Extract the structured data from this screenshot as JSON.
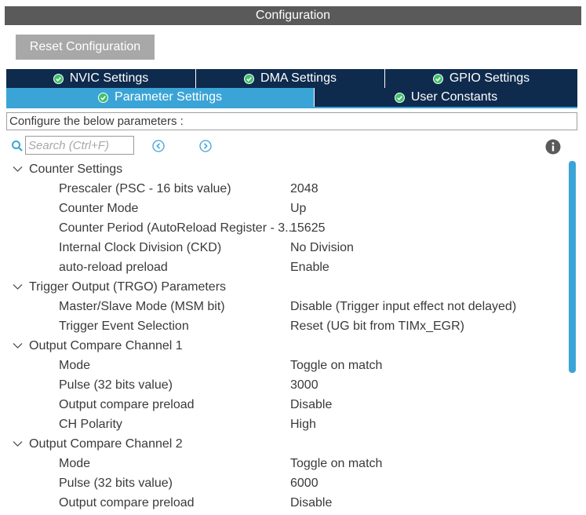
{
  "window": {
    "title": "Configuration"
  },
  "toolbar": {
    "reset_label": "Reset Configuration"
  },
  "tabs_top": [
    {
      "label": "NVIC Settings"
    },
    {
      "label": "DMA Settings"
    },
    {
      "label": "GPIO Settings"
    }
  ],
  "tabs_bottom": [
    {
      "label": "Parameter Settings",
      "active": true
    },
    {
      "label": "User Constants"
    }
  ],
  "describe": "Configure the below parameters :",
  "search": {
    "placeholder": "Search (Ctrl+F)"
  },
  "groups": [
    {
      "label": "Counter Settings",
      "params": [
        {
          "name": "Prescaler (PSC - 16 bits value)",
          "value": "2048"
        },
        {
          "name": "Counter Mode",
          "value": "Up"
        },
        {
          "name": "Counter Period (AutoReload Register - 3...",
          "value": "15625"
        },
        {
          "name": "Internal Clock Division (CKD)",
          "value": "No Division"
        },
        {
          "name": "auto-reload preload",
          "value": "Enable"
        }
      ]
    },
    {
      "label": "Trigger Output (TRGO) Parameters",
      "params": [
        {
          "name": "Master/Slave Mode (MSM bit)",
          "value": "Disable (Trigger input effect not delayed)"
        },
        {
          "name": "Trigger Event Selection",
          "value": "Reset (UG bit from TIMx_EGR)"
        }
      ]
    },
    {
      "label": "Output Compare Channel 1",
      "params": [
        {
          "name": "Mode",
          "value": "Toggle on match"
        },
        {
          "name": "Pulse (32 bits value)",
          "value": "3000"
        },
        {
          "name": "Output compare preload",
          "value": "Disable"
        },
        {
          "name": "CH Polarity",
          "value": "High"
        }
      ]
    },
    {
      "label": "Output Compare Channel 2",
      "params": [
        {
          "name": "Mode",
          "value": "Toggle on match"
        },
        {
          "name": "Pulse (32 bits value)",
          "value": "6000"
        },
        {
          "name": "Output compare preload",
          "value": "Disable"
        }
      ]
    }
  ],
  "colors": {
    "tab_dark": "#0e2a4d",
    "tab_active": "#3ba4d6",
    "check_green": "#3ec26b",
    "title_bar": "#5a5a5a"
  },
  "icons": [
    "check-icon",
    "search-icon",
    "arrow-left-icon",
    "arrow-right-icon",
    "info-icon",
    "chevron-down-icon"
  ]
}
